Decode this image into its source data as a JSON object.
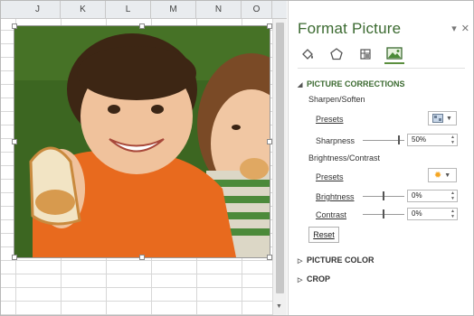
{
  "sheet": {
    "columns": [
      "J",
      "K",
      "L",
      "M",
      "N",
      "O"
    ]
  },
  "pane": {
    "title": "Format Picture",
    "controls": {
      "options_glyph": "▾",
      "close_glyph": "✕"
    },
    "tabs": [
      {
        "icon": "fill-line-icon"
      },
      {
        "icon": "effects-pentagon-icon"
      },
      {
        "icon": "size-properties-icon"
      },
      {
        "icon": "picture-icon",
        "active": true
      }
    ],
    "picture_corrections": {
      "header": "PICTURE CORRECTIONS",
      "sharpen_soften": {
        "label": "Sharpen/Soften",
        "presets_label": "Presets",
        "sharpness_label": "Sharpness",
        "sharpness_value": "50%",
        "sharpness_level": 0.88
      },
      "brightness_contrast": {
        "label": "Brightness/Contrast",
        "presets_label": "Presets",
        "brightness_label": "Brightness",
        "brightness_value": "0%",
        "brightness_level": 0.5,
        "contrast_label": "Contrast",
        "contrast_value": "0%",
        "contrast_level": 0.5
      },
      "reset_label": "Reset"
    },
    "picture_color": {
      "header": "PICTURE COLOR"
    },
    "crop": {
      "header": "CROP"
    }
  },
  "colors": {
    "accent_green": "#3b6a30",
    "preset_sun": "#f5a623"
  }
}
